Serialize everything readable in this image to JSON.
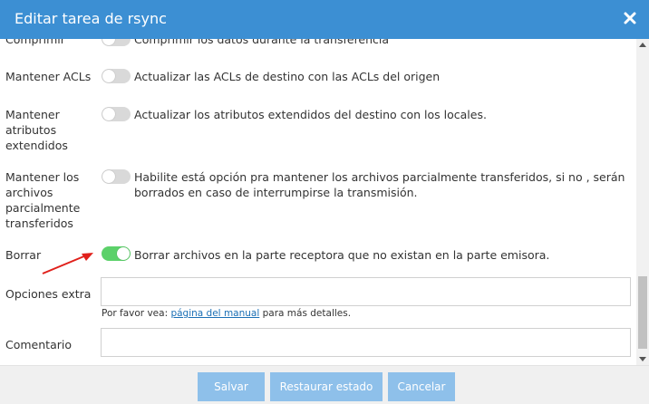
{
  "dialog": {
    "title": "Editar tarea de rsync"
  },
  "rows": [
    {
      "label": "Comprimir",
      "description": "Comprimir los datos durante la transferencia",
      "enabled": false
    },
    {
      "label": "Mantener ACLs",
      "description": "Actualizar las ACLs de destino con las ACLs del origen",
      "enabled": false
    },
    {
      "label": "Mantener atributos extendidos",
      "description": "Actualizar los atributos extendidos del destino con los locales.",
      "enabled": false
    },
    {
      "label": "Mantener los archivos parcialmente transferidos",
      "description": "Habilite está opción pra mantener los archivos parcialmente transferidos, si no , serán borrados en caso de interrumpirse la transmisión.",
      "enabled": false
    },
    {
      "label": "Borrar",
      "description": "Borrar archivos en la parte receptora que no existan en la parte emisora.",
      "enabled": true
    }
  ],
  "extra_options": {
    "label": "Opciones extra",
    "value": "",
    "hint_prefix": "Por favor vea:",
    "hint_link": "página del manual",
    "hint_suffix": "para más detalles."
  },
  "comment": {
    "label": "Comentario",
    "value": ""
  },
  "buttons": {
    "save": "Salvar",
    "reset": "Restaurar estado",
    "cancel": "Cancelar"
  },
  "colors": {
    "titlebar": "#3c8fd3",
    "toggle_on": "#5cd16a",
    "toggle_off": "#d9d9d9",
    "button": "#8ec0ea",
    "annotation_arrow": "#e0201b"
  }
}
